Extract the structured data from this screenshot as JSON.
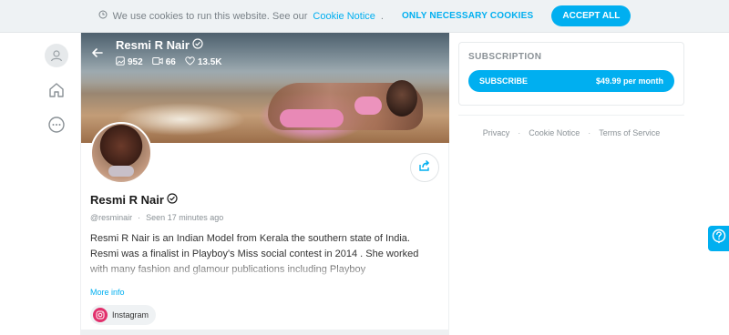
{
  "cookie": {
    "text": "We use cookies to run this website. See our",
    "link": "Cookie Notice",
    "period": ".",
    "necessary_label": "ONLY NECESSARY COOKIES",
    "accept_label": "ACCEPT ALL"
  },
  "profile": {
    "name": "Resmi R Nair",
    "handle": "@resminair",
    "seen_label": "Seen",
    "seen_time": "17 minutes ago",
    "stats": {
      "photos": "952",
      "videos": "66",
      "likes": "13.5K"
    },
    "bio": "Resmi R Nair is an Indian Model from Kerala the southern state of India. Resmi was a finalist in Playboy's Miss social contest in 2014 . She worked with many fashion and glamour publications including Playboy",
    "more_info": "More info",
    "instagram_label": "Instagram"
  },
  "subscription": {
    "title": "SUBSCRIPTION",
    "button_label": "SUBSCRIBE",
    "price": "$49.99 per month"
  },
  "footer": {
    "links": [
      "Privacy",
      "Cookie Notice",
      "Terms of Service"
    ],
    "separator": "·"
  },
  "colors": {
    "accent": "#00aff0",
    "instagram": "#e1306c"
  },
  "icons": [
    "clock-icon",
    "user-avatar-icon",
    "home-icon",
    "more-icon",
    "back-arrow-icon",
    "verified-icon",
    "image-icon",
    "video-icon",
    "heart-icon",
    "share-icon",
    "instagram-icon",
    "help-icon"
  ]
}
